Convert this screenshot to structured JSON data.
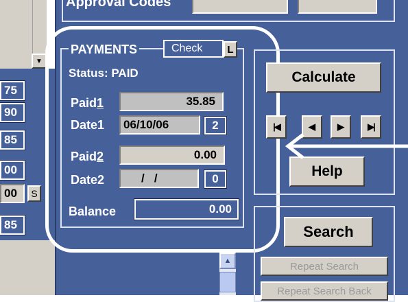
{
  "top": {
    "approval_label": "Approval Codes"
  },
  "left_column": {
    "values": [
      "75",
      "90",
      "85",
      "00",
      "00",
      "85"
    ],
    "s_button": "S"
  },
  "payments": {
    "title": "PAYMENTS",
    "check_label": "Check",
    "l_label": "L",
    "status": "Status: PAID",
    "paid1_label": "Paid",
    "paid1_num": "1",
    "paid1_value": "35.85",
    "date1_label": "Date1",
    "date1_value": "06/10/06",
    "date1_count": "2",
    "paid2_label": "Paid",
    "paid2_num": "2",
    "paid2_value": "0.00",
    "date2_label": "Date2",
    "date2_value": "/   /",
    "date2_count": "0",
    "balance_label": "Balance",
    "balance_value": "0.00"
  },
  "actions": {
    "calculate": "Calculate",
    "help": "Help",
    "search": "Search",
    "repeat_search": "Repeat Search",
    "repeat_search_back": "Repeat Search Back"
  },
  "icons": [
    "first-record-icon",
    "prev-record-icon",
    "next-record-icon",
    "last-record-icon"
  ],
  "colors": {
    "panel_blue": "#46619a",
    "button_gray": "#d4d0c8",
    "highlight": "#ffffff"
  }
}
